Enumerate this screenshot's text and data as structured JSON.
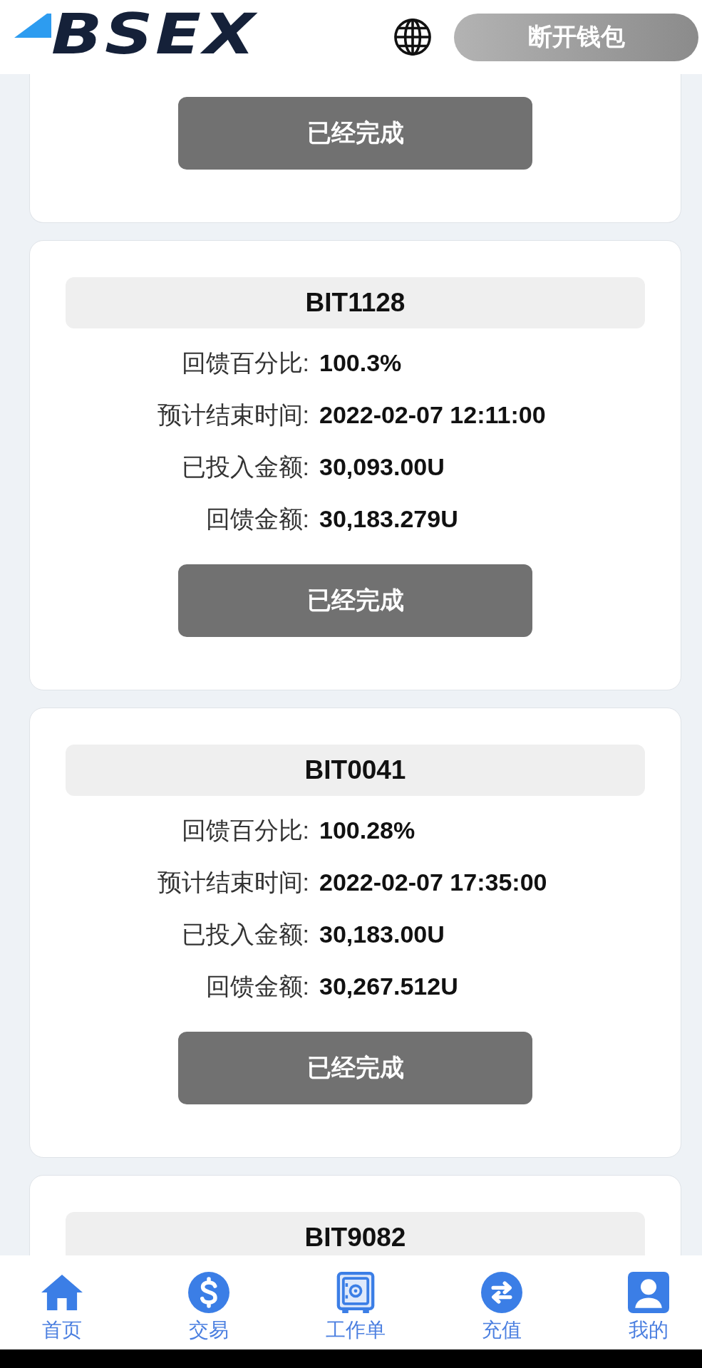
{
  "header": {
    "logo": "BSEX",
    "disconnect_button": "断开钱包"
  },
  "cards": [
    {
      "button": "已经完成"
    },
    {
      "title": "BIT1128",
      "rows": [
        {
          "label": "回馈百分比:",
          "value": "100.3%"
        },
        {
          "label": "预计结束时间:",
          "value": "2022-02-07 12:11:00"
        },
        {
          "label": "已投入金额:",
          "value": "30,093.00U"
        },
        {
          "label": "回馈金额:",
          "value": "30,183.279U"
        }
      ],
      "button": "已经完成"
    },
    {
      "title": "BIT0041",
      "rows": [
        {
          "label": "回馈百分比:",
          "value": "100.28%"
        },
        {
          "label": "预计结束时间:",
          "value": "2022-02-07 17:35:00"
        },
        {
          "label": "已投入金额:",
          "value": "30,183.00U"
        },
        {
          "label": "回馈金额:",
          "value": "30,267.512U"
        }
      ],
      "button": "已经完成"
    },
    {
      "title": "BIT9082"
    }
  ],
  "bottom_nav": [
    {
      "label": "首页"
    },
    {
      "label": "交易"
    },
    {
      "label": "工作单"
    },
    {
      "label": "充值"
    },
    {
      "label": "我的"
    }
  ]
}
